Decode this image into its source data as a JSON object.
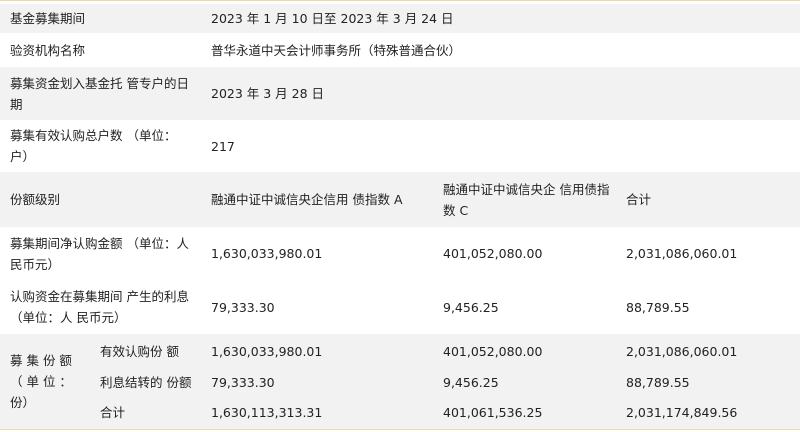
{
  "rows": {
    "period": {
      "label": "基金募集期间",
      "value": "2023 年 1 月 10 日至 2023 年 3 月 24 日"
    },
    "audit": {
      "label": "验资机构名称",
      "value": "普华永道中天会计师事务所（特殊普通合伙）"
    },
    "transfer_date": {
      "label": "募集资金划入基金托 管专户的日期",
      "value": "2023 年 3 月 28 日"
    },
    "accounts": {
      "label": "募集有效认购总户数 （单位：户）",
      "value": "217"
    },
    "class_header": {
      "label": "份额级别",
      "col_a": "融通中证中诚信央企信用 债指数 A",
      "col_c": "融通中证中诚信央企 信用债指数 C",
      "col_total": "合计"
    },
    "net_amount": {
      "label": "募集期间净认购金额 （单位：人民币元）",
      "a": "1,630,033,980.01",
      "c": "401,052,080.00",
      "total": "2,031,086,060.01"
    },
    "interest": {
      "label": "认购资金在募集期间 产生的利息（单位：人 民币元）",
      "a": "79,333.30",
      "c": "9,456.25",
      "total": "88,789.55"
    },
    "shares": {
      "group_label": "募 集 份 额 （ 单 位 ： 份）",
      "sub": [
        {
          "label": "有效认购份 额",
          "a": "1,630,033,980.01",
          "c": "401,052,080.00",
          "total": "2,031,086,060.01"
        },
        {
          "label": "利息结转的 份额",
          "a": "79,333.30",
          "c": "9,456.25",
          "total": "88,789.55"
        },
        {
          "label": "合计",
          "a": "1,630,113,313.31",
          "c": "401,061,536.25",
          "total": "2,031,174,849.56"
        }
      ]
    }
  }
}
